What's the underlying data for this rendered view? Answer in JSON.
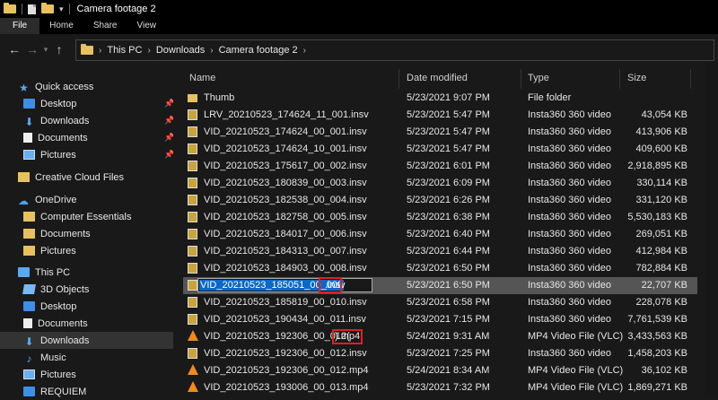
{
  "window": {
    "title": "Camera footage 2"
  },
  "ribbon": {
    "tabs": [
      "File",
      "Home",
      "Share",
      "View"
    ]
  },
  "address": {
    "crumbs": [
      "This PC",
      "Downloads",
      "Camera footage 2"
    ]
  },
  "columns": {
    "name": "Name",
    "date": "Date modified",
    "type": "Type",
    "size": "Size"
  },
  "sidebar": {
    "items": [
      {
        "label": "Quick access",
        "icon": "star-icon"
      },
      {
        "label": "Desktop",
        "icon": "desktop-icon",
        "pinned": true
      },
      {
        "label": "Downloads",
        "icon": "download-icon",
        "pinned": true
      },
      {
        "label": "Documents",
        "icon": "document-icon",
        "pinned": true
      },
      {
        "label": "Pictures",
        "icon": "pictures-icon",
        "pinned": true
      },
      {
        "label": "Creative Cloud Files",
        "icon": "folder-icon"
      },
      {
        "label": "OneDrive",
        "icon": "cloud-icon"
      },
      {
        "label": "Computer Essentials",
        "icon": "folder-icon"
      },
      {
        "label": "Documents",
        "icon": "folder-icon"
      },
      {
        "label": "Pictures",
        "icon": "folder-icon"
      },
      {
        "label": "This PC",
        "icon": "pc-icon"
      },
      {
        "label": "3D Objects",
        "icon": "objects-3d-icon"
      },
      {
        "label": "Desktop",
        "icon": "desktop-icon"
      },
      {
        "label": "Documents",
        "icon": "document-icon"
      },
      {
        "label": "Downloads",
        "icon": "download-icon"
      },
      {
        "label": "Music",
        "icon": "music-icon"
      },
      {
        "label": "Pictures",
        "icon": "pictures-icon"
      },
      {
        "label": "REQUIEM",
        "icon": "drive-icon"
      }
    ]
  },
  "files": [
    {
      "name": "Thumb",
      "date": "5/23/2021 9:07 PM",
      "type": "File folder",
      "size": "",
      "icon": "folder-icon"
    },
    {
      "name": "LRV_20210523_174624_11_001.insv",
      "date": "5/23/2021 5:47 PM",
      "type": "Insta360 360 video",
      "size": "43,054 KB",
      "icon": "video-file-icon"
    },
    {
      "name": "VID_20210523_174624_00_001.insv",
      "date": "5/23/2021 5:47 PM",
      "type": "Insta360 360 video",
      "size": "413,906 KB",
      "icon": "video-file-icon"
    },
    {
      "name": "VID_20210523_174624_10_001.insv",
      "date": "5/23/2021 5:47 PM",
      "type": "Insta360 360 video",
      "size": "409,600 KB",
      "icon": "video-file-icon"
    },
    {
      "name": "VID_20210523_175617_00_002.insv",
      "date": "5/23/2021 6:01 PM",
      "type": "Insta360 360 video",
      "size": "2,918,895 KB",
      "icon": "video-file-icon"
    },
    {
      "name": "VID_20210523_180839_00_003.insv",
      "date": "5/23/2021 6:09 PM",
      "type": "Insta360 360 video",
      "size": "330,114 KB",
      "icon": "video-file-icon"
    },
    {
      "name": "VID_20210523_182538_00_004.insv",
      "date": "5/23/2021 6:26 PM",
      "type": "Insta360 360 video",
      "size": "331,120 KB",
      "icon": "video-file-icon"
    },
    {
      "name": "VID_20210523_182758_00_005.insv",
      "date": "5/23/2021 6:38 PM",
      "type": "Insta360 360 video",
      "size": "5,530,183 KB",
      "icon": "video-file-icon"
    },
    {
      "name": "VID_20210523_184017_00_006.insv",
      "date": "5/23/2021 6:40 PM",
      "type": "Insta360 360 video",
      "size": "269,051 KB",
      "icon": "video-file-icon"
    },
    {
      "name": "VID_20210523_184313_00_007.insv",
      "date": "5/23/2021 6:44 PM",
      "type": "Insta360 360 video",
      "size": "412,984 KB",
      "icon": "video-file-icon"
    },
    {
      "name": "VID_20210523_184903_00_008.insv",
      "date": "5/23/2021 6:50 PM",
      "type": "Insta360 360 video",
      "size": "782,884 KB",
      "icon": "video-file-icon"
    },
    {
      "name": "VID_20210523_185051_00_009.insv",
      "date": "5/23/2021 6:50 PM",
      "type": "Insta360 360 video",
      "size": "22,707 KB",
      "icon": "video-file-icon",
      "renaming": true,
      "rename_selected": "VID_20210523_185051_00_009",
      "rename_rest": ".insv"
    },
    {
      "name": "VID_20210523_185819_00_010.insv",
      "date": "5/23/2021 6:58 PM",
      "type": "Insta360 360 video",
      "size": "228,078 KB",
      "icon": "video-file-icon"
    },
    {
      "name": "VID_20210523_190434_00_011.insv",
      "date": "5/23/2021 7:15 PM",
      "type": "Insta360 360 video",
      "size": "7,761,539 KB",
      "icon": "video-file-icon"
    },
    {
      "name": "VID_20210523_192306_00_012(1).mp4",
      "date": "5/24/2021 9:31 AM",
      "type": "MP4 Video File (VLC)",
      "size": "3,433,563 KB",
      "icon": "vlc-cone-icon",
      "name_main": "VID_20210523_192306_00_012(",
      "name_boxed": ").mp4"
    },
    {
      "name": "VID_20210523_192306_00_012.insv",
      "date": "5/23/2021 7:25 PM",
      "type": "Insta360 360 video",
      "size": "1,458,203 KB",
      "icon": "video-file-icon"
    },
    {
      "name": "VID_20210523_192306_00_012.mp4",
      "date": "5/24/2021 8:34 AM",
      "type": "MP4 Video File (VLC)",
      "size": "36,102 KB",
      "icon": "vlc-cone-icon"
    },
    {
      "name": "VID_20210523_193006_00_013.mp4",
      "date": "5/23/2021 7:32 PM",
      "type": "MP4 Video File (VLC)",
      "size": "1,869,271 KB",
      "icon": "vlc-cone-icon"
    }
  ],
  "colors": {
    "background": "#191919",
    "selection": "#555555",
    "highlight": "#0b67c8",
    "annotation": "#e02020"
  }
}
